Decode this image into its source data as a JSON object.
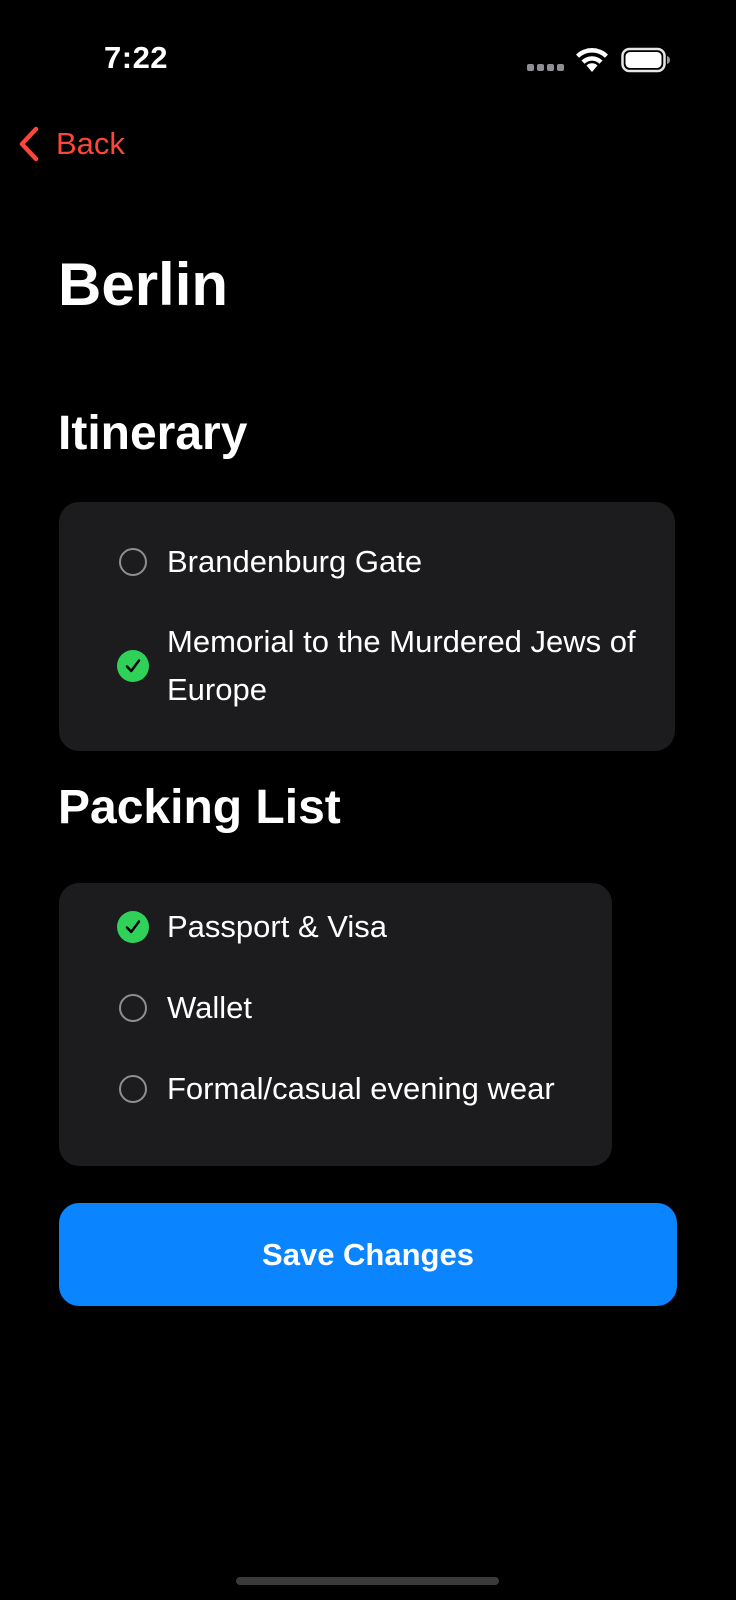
{
  "status_bar": {
    "time": "7:22"
  },
  "nav": {
    "back_label": "Back"
  },
  "page": {
    "title": "Berlin"
  },
  "itinerary": {
    "title": "Itinerary",
    "items": [
      {
        "label": "Brandenburg Gate",
        "checked": false
      },
      {
        "label": "Memorial to the Murdered Jews of Europe",
        "checked": true
      }
    ]
  },
  "packing_list": {
    "title": "Packing List",
    "items": [
      {
        "label": "Passport & Visa",
        "checked": true
      },
      {
        "label": "Wallet",
        "checked": false
      },
      {
        "label": "Formal/casual evening wear",
        "checked": false
      }
    ]
  },
  "actions": {
    "save_label": "Save Changes"
  },
  "colors": {
    "background": "#000000",
    "card": "#1c1c1e",
    "accent_back": "#ff453a",
    "check": "#30d158",
    "primary_button": "#0a84ff"
  }
}
